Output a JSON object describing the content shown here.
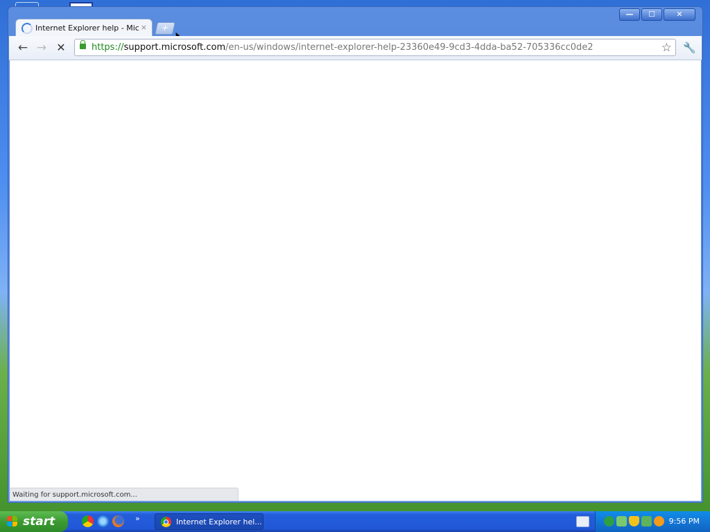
{
  "window": {
    "controls": {
      "minimize": "—",
      "maximize": "☐",
      "close": "✕"
    }
  },
  "tab": {
    "title": "Internet Explorer help - Micros",
    "close": "×",
    "new_tab": "+"
  },
  "toolbar": {
    "back": "←",
    "forward": "→",
    "stop": "✕",
    "url_scheme": "https://",
    "url_host": "support.microsoft.com",
    "url_path": "/en-us/windows/internet-explorer-help-23360e49-9cd3-4dda-ba52-705336cc0de2",
    "star": "☆",
    "wrench": "🔧"
  },
  "status": {
    "text": "Waiting for support.microsoft.com..."
  },
  "taskbar": {
    "start_label": "start",
    "more": "»",
    "task_button_label": "Internet Explorer hel...",
    "clock": "9:56 PM"
  },
  "colors": {
    "xp_blue": "#245edb",
    "start_green": "#3c9b32",
    "secure_green": "#1f8a1f"
  }
}
